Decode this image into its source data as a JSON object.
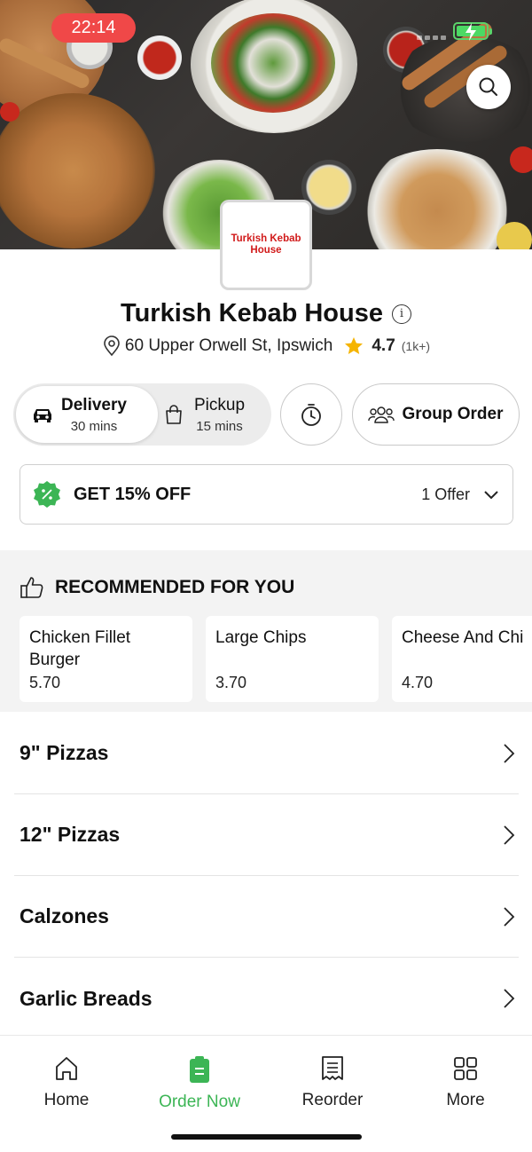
{
  "status_bar": {
    "time": "22:14"
  },
  "restaurant": {
    "logo_text": "Turkish Kebab House",
    "name": "Turkish Kebab House",
    "address": "60 Upper Orwell St, Ipswich",
    "rating": "4.7",
    "rating_count": "(1k+)"
  },
  "order_mode": {
    "delivery": {
      "label": "Delivery",
      "time": "30 mins"
    },
    "pickup": {
      "label": "Pickup",
      "time": "15 mins"
    },
    "group_order_label": "Group Order"
  },
  "offer": {
    "label": "GET 15% OFF",
    "count": "1 Offer"
  },
  "recommended": {
    "heading": "RECOMMENDED FOR YOU",
    "items": [
      {
        "name": "Chicken Fillet Burger",
        "price": "5.70"
      },
      {
        "name": "Large Chips",
        "price": "3.70"
      },
      {
        "name": "Cheese And Chi",
        "price": "4.70"
      }
    ]
  },
  "categories": [
    {
      "label": "9\" Pizzas"
    },
    {
      "label": "12\" Pizzas"
    },
    {
      "label": "Calzones"
    },
    {
      "label": "Garlic Breads"
    }
  ],
  "tabs": [
    {
      "label": "Home",
      "icon": "home-icon"
    },
    {
      "label": "Order Now",
      "icon": "order-icon"
    },
    {
      "label": "Reorder",
      "icon": "receipt-icon"
    },
    {
      "label": "More",
      "icon": "grid-icon"
    }
  ],
  "colors": {
    "accent": "#3cb555",
    "time_pill": "#f04848",
    "logo_text": "#d11a1a",
    "rating_star": "#f5b400"
  }
}
